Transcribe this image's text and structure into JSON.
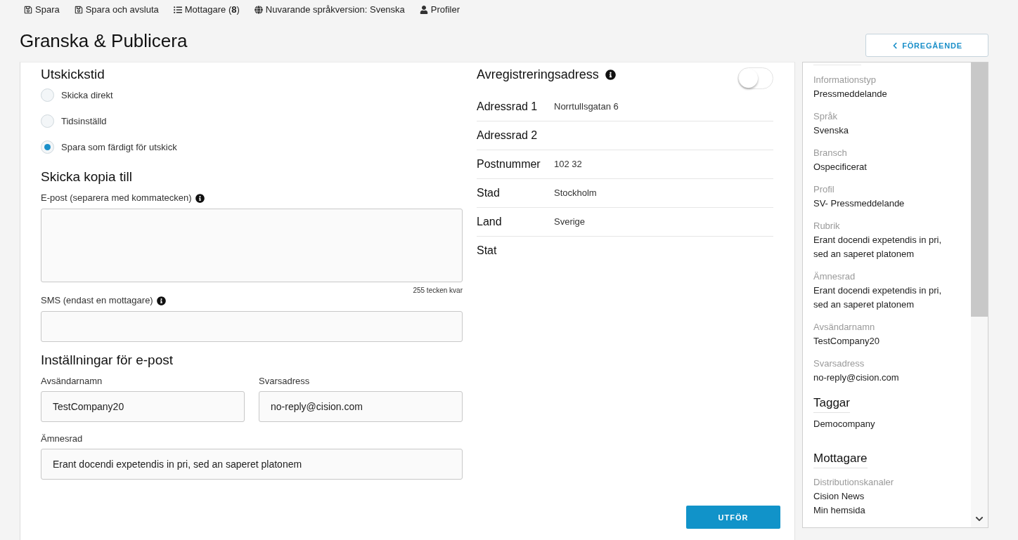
{
  "toolbar": {
    "items": [
      {
        "kind": "save",
        "label": "Spara"
      },
      {
        "kind": "finish",
        "label": "Spara och avsluta"
      },
      {
        "kind": "recipients",
        "label": "Mottagare (**8**)"
      },
      {
        "kind": "language",
        "label": "Nuvarande språkversion: Svenska"
      },
      {
        "kind": "profiles",
        "label": "Profiler"
      }
    ]
  },
  "header": {
    "title": "Granska & Publicera",
    "back_button": "FÖREGÅENDE"
  },
  "send_time": {
    "heading": "Utskickstid",
    "options": [
      {
        "label": "Skicka direkt",
        "selected": false
      },
      {
        "label": "Tidsinställd",
        "selected": false
      },
      {
        "label": "Spara som färdigt för utskick",
        "selected": true
      }
    ]
  },
  "copy_to": {
    "heading": "Skicka kopia till",
    "email": {
      "label": "E-post (separera med kommatecken)",
      "counter": "255 tecken kvar"
    },
    "sms": {
      "label": "SMS (endast en mottagare)"
    }
  },
  "email_settings": {
    "heading": "Inställningar för e-post",
    "fields": [
      {
        "label": "Avsändarnamn",
        "value": "TestCompany20"
      },
      {
        "label": "Svarsadress",
        "value": "no-reply@cision.com"
      },
      {
        "label": "Ämnesrad",
        "value": "Erant docendi expetendis in pri, sed an saperet platonem"
      }
    ]
  },
  "unsubscribe": {
    "heading": "Avregistreringsadress",
    "on": false,
    "rows": [
      {
        "label": "Adressrad 1",
        "value": "Norrtullsgatan 6"
      },
      {
        "label": "Adressrad 2"
      },
      {
        "label": "Postnummer",
        "value": "102 32"
      },
      {
        "label": "Stad",
        "value": "Stockholm"
      },
      {
        "label": "Land",
        "value": "Sverige"
      },
      {
        "label": "Stat"
      }
    ]
  },
  "submit_button": "UTFÖR",
  "summary": {
    "fields": [
      {
        "label": "Informationstyp",
        "value": "Pressmeddelande"
      },
      {
        "label": "Språk",
        "value": "Svenska"
      },
      {
        "label": "Bransch",
        "value": "Ospecificerat"
      },
      {
        "label": "Profil",
        "value": "SV- Pressmeddelande"
      },
      {
        "label": "Rubrik",
        "value": "Erant docendi expetendis in pri, sed an saperet platonem"
      },
      {
        "label": "Ämnesrad",
        "value": "Erant docendi expetendis in pri, sed an saperet platonem"
      },
      {
        "label": "Avsändarnamn",
        "value": "TestCompany20"
      },
      {
        "label": "Svarsadress",
        "value": "no-reply@cision.com"
      }
    ],
    "tags": {
      "heading": "Taggar",
      "items": [
        "Democompany"
      ]
    },
    "recipients": {
      "heading": "Mottagare",
      "label": "Distributionskanaler",
      "items": [
        "Cision News",
        "Min hemsida"
      ]
    }
  }
}
